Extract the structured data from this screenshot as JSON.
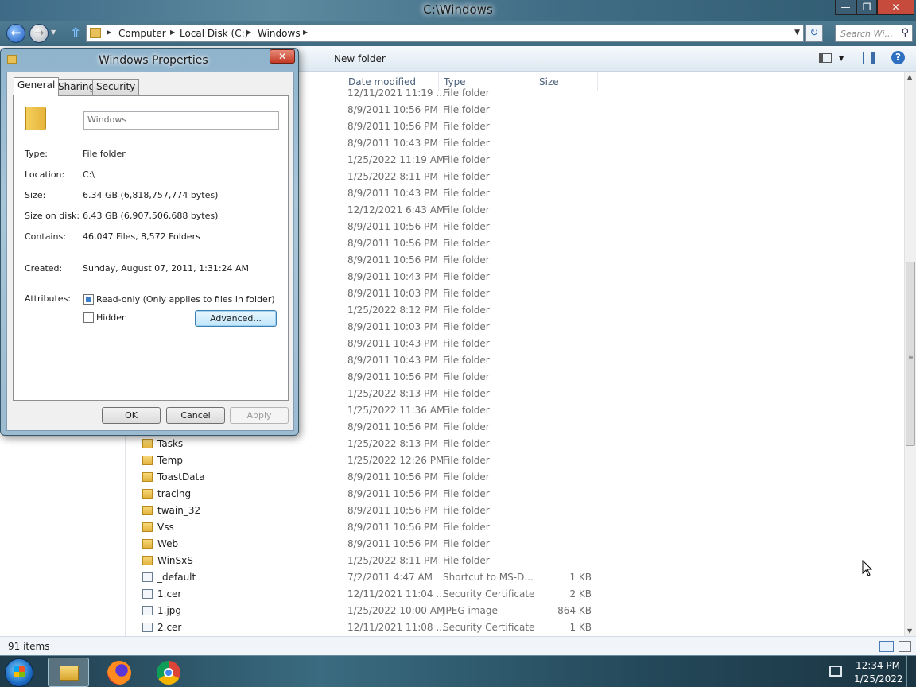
{
  "window": {
    "title": "C:\\Windows",
    "minimize_icon": "minimize-icon",
    "maximize_icon": "restore-icon",
    "close_icon": "close-icon"
  },
  "address_bar": {
    "crumbs": [
      "Computer",
      "Local Disk (C:)",
      "Windows"
    ],
    "search_placeholder": "Search Wi..."
  },
  "command_bar": {
    "new_folder": "New folder"
  },
  "columns": {
    "date": "Date modified",
    "type": "Type",
    "size": "Size"
  },
  "files": [
    {
      "name": "",
      "date": "12/11/2021 11:19 ...",
      "type": "File folder",
      "size": "",
      "kind": "folder"
    },
    {
      "name": "",
      "date": "8/9/2011 10:56 PM",
      "type": "File folder",
      "size": "",
      "kind": "folder"
    },
    {
      "name": "",
      "date": "8/9/2011 10:56 PM",
      "type": "File folder",
      "size": "",
      "kind": "folder"
    },
    {
      "name": "",
      "date": "8/9/2011 10:43 PM",
      "type": "File folder",
      "size": "",
      "kind": "folder"
    },
    {
      "name": "",
      "date": "1/25/2022 11:19 AM",
      "type": "File folder",
      "size": "",
      "kind": "folder"
    },
    {
      "name": "",
      "date": "1/25/2022 8:11 PM",
      "type": "File folder",
      "size": "",
      "kind": "folder"
    },
    {
      "name": "",
      "date": "8/9/2011 10:43 PM",
      "type": "File folder",
      "size": "",
      "kind": "folder"
    },
    {
      "name": "",
      "date": "12/12/2021 6:43 AM",
      "type": "File folder",
      "size": "",
      "kind": "folder"
    },
    {
      "name": "",
      "date": "8/9/2011 10:56 PM",
      "type": "File folder",
      "size": "",
      "kind": "folder"
    },
    {
      "name": "",
      "date": "8/9/2011 10:56 PM",
      "type": "File folder",
      "size": "",
      "kind": "folder"
    },
    {
      "name": "",
      "date": "8/9/2011 10:56 PM",
      "type": "File folder",
      "size": "",
      "kind": "folder"
    },
    {
      "name": "",
      "date": "8/9/2011 10:43 PM",
      "type": "File folder",
      "size": "",
      "kind": "folder"
    },
    {
      "name": "",
      "date": "8/9/2011 10:03 PM",
      "type": "File folder",
      "size": "",
      "kind": "folder"
    },
    {
      "name": "",
      "date": "1/25/2022 8:12 PM",
      "type": "File folder",
      "size": "",
      "kind": "folder"
    },
    {
      "name": "",
      "date": "8/9/2011 10:03 PM",
      "type": "File folder",
      "size": "",
      "kind": "folder"
    },
    {
      "name": "",
      "date": "8/9/2011 10:43 PM",
      "type": "File folder",
      "size": "",
      "kind": "folder"
    },
    {
      "name": "",
      "date": "8/9/2011 10:43 PM",
      "type": "File folder",
      "size": "",
      "kind": "folder"
    },
    {
      "name": "",
      "date": "8/9/2011 10:56 PM",
      "type": "File folder",
      "size": "",
      "kind": "folder"
    },
    {
      "name": "",
      "date": "1/25/2022 8:13 PM",
      "type": "File folder",
      "size": "",
      "kind": "folder"
    },
    {
      "name": "",
      "date": "1/25/2022 11:36 AM",
      "type": "File folder",
      "size": "",
      "kind": "folder"
    },
    {
      "name": "",
      "date": "8/9/2011 10:56 PM",
      "type": "File folder",
      "size": "",
      "kind": "folder"
    },
    {
      "name": "Tasks",
      "date": "1/25/2022 8:13 PM",
      "type": "File folder",
      "size": "",
      "kind": "folder"
    },
    {
      "name": "Temp",
      "date": "1/25/2022 12:26 PM",
      "type": "File folder",
      "size": "",
      "kind": "folder"
    },
    {
      "name": "ToastData",
      "date": "8/9/2011 10:56 PM",
      "type": "File folder",
      "size": "",
      "kind": "folder"
    },
    {
      "name": "tracing",
      "date": "8/9/2011 10:56 PM",
      "type": "File folder",
      "size": "",
      "kind": "folder"
    },
    {
      "name": "twain_32",
      "date": "8/9/2011 10:56 PM",
      "type": "File folder",
      "size": "",
      "kind": "folder"
    },
    {
      "name": "Vss",
      "date": "8/9/2011 10:56 PM",
      "type": "File folder",
      "size": "",
      "kind": "folder"
    },
    {
      "name": "Web",
      "date": "8/9/2011 10:56 PM",
      "type": "File folder",
      "size": "",
      "kind": "folder"
    },
    {
      "name": "WinSxS",
      "date": "1/25/2022 8:11 PM",
      "type": "File folder",
      "size": "",
      "kind": "folder"
    },
    {
      "name": "_default",
      "date": "7/2/2011 4:47 AM",
      "type": "Shortcut to MS-D...",
      "size": "1 KB",
      "kind": "file"
    },
    {
      "name": "1.cer",
      "date": "12/11/2021 11:04 ...",
      "type": "Security Certificate",
      "size": "2 KB",
      "kind": "file"
    },
    {
      "name": "1.jpg",
      "date": "1/25/2022 10:00 AM",
      "type": "JPEG image",
      "size": "864 KB",
      "kind": "file"
    },
    {
      "name": "2.cer",
      "date": "12/11/2021 11:08 ...",
      "type": "Security Certificate",
      "size": "1 KB",
      "kind": "file"
    }
  ],
  "status": {
    "items": "91 items"
  },
  "taskbar": {
    "time": "12:34 PM",
    "date": "1/25/2022"
  },
  "scrollbar": {
    "thumb_start": 0.33,
    "thumb_end": 0.67
  },
  "dialog": {
    "title": "Windows Properties",
    "tabs": [
      "General",
      "Sharing",
      "Security"
    ],
    "active_tab": "General",
    "name_value": "Windows",
    "props": [
      {
        "label": "Type:",
        "value": "File folder"
      },
      {
        "label": "Location:",
        "value": "C:\\"
      },
      {
        "label": "Size:",
        "value": "6.34 GB (6,818,757,774 bytes)"
      },
      {
        "label": "Size on disk:",
        "value": "6.43 GB (6,907,506,688 bytes)"
      },
      {
        "label": "Contains:",
        "value": "46,047 Files, 8,572 Folders"
      }
    ],
    "created_label": "Created:",
    "created_value": "Sunday, August 07, 2011, 1:31:24 AM",
    "attributes_label": "Attributes:",
    "readonly_label": "Read-only (Only applies to files in folder)",
    "hidden_label": "Hidden",
    "advanced_label": "Advanced...",
    "ok": "OK",
    "cancel": "Cancel",
    "apply": "Apply"
  }
}
